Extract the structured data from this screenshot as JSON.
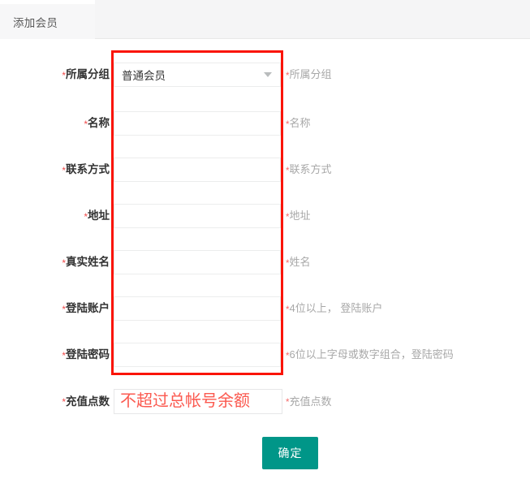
{
  "header": {
    "tab_label": "添加会员"
  },
  "form": {
    "rows": [
      {
        "label": "所属分组",
        "required_mark": "*",
        "type": "select",
        "value": "普通会员",
        "hint": "所属分组",
        "hint_mark": "*",
        "caret_icon": "chevron-down-icon"
      },
      {
        "label": "名称",
        "required_mark": "*",
        "type": "text",
        "value": "",
        "placeholder": "",
        "hint": "名称",
        "hint_mark": "*"
      },
      {
        "label": "联系方式",
        "required_mark": "*",
        "type": "text",
        "value": "",
        "placeholder": "",
        "hint": "联系方式",
        "hint_mark": "*"
      },
      {
        "label": "地址",
        "required_mark": "*",
        "type": "text",
        "value": "",
        "placeholder": "",
        "hint": "地址",
        "hint_mark": "*"
      },
      {
        "label": "真实姓名",
        "required_mark": "*",
        "type": "text",
        "value": "",
        "placeholder": "",
        "hint": "姓名",
        "hint_mark": "*"
      },
      {
        "label": "登陆账户",
        "required_mark": "*",
        "type": "text",
        "value": "",
        "placeholder": "",
        "hint": "4位以上，  登陆账户",
        "hint_mark": "*"
      },
      {
        "label": "登陆密码",
        "required_mark": "*",
        "type": "text",
        "value": "",
        "placeholder": "",
        "hint": "6位以上字母或数字组合，登陆密码",
        "hint_mark": "*"
      }
    ],
    "points_row": {
      "label": "充值点数",
      "required_mark": "*",
      "value": "",
      "placeholder": "不超过总帐号余额",
      "hint": "充值点数",
      "hint_mark": "*"
    },
    "submit_label": "确定"
  },
  "colors": {
    "highlight_border": "#fa1405",
    "submit_bg": "#009688",
    "required_star": "#f04b4b",
    "placeholder_red": "#fb5a50"
  }
}
